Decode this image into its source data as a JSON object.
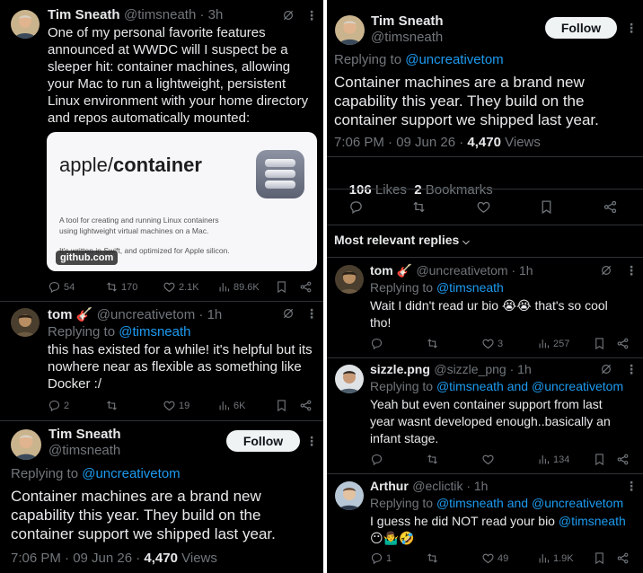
{
  "left": {
    "tweet1": {
      "name": "Tim Sneath",
      "handle_time": "@timsneath · 3h",
      "lines": [
        "One of my personal favorite features",
        "announced at WWDC will I suspect be a",
        "sleeper hit: container machines, allowing",
        "your Mac to run a lightweight, persistent",
        "Linux environment with your home directory",
        "and repos automatically mounted:"
      ],
      "card": {
        "title_prefix": "apple/",
        "title_bold": "container",
        "desc_line1": "A tool for creating and running Linux containers",
        "desc_line2": "using lightweight virtual machines on a Mac.",
        "foot": "It's written in Swift, and optimized for Apple silicon.",
        "domain": "github.com"
      },
      "replies": "54",
      "reposts": "170",
      "likes": "2.1K",
      "views": "89.6K"
    },
    "tweet2": {
      "name": "tom 🎸",
      "handle_time": "@uncreativetom · 1h",
      "replying_prefix": "Replying to",
      "replying_to": "@timsneath",
      "lines": [
        "this has existed for a while! it's helpful but its",
        "nowhere near as flexible as something like",
        "Docker :/"
      ],
      "replies": "2",
      "reposts": "",
      "likes": "19",
      "views": "6K"
    },
    "tweet3": {
      "name": "Tim Sneath",
      "handle": "@timsneath",
      "follow_label": "Follow",
      "replying_prefix": "Replying to",
      "replying_to": "@uncreativetom",
      "lines": [
        "Container machines are a brand new",
        "capability this year. They build on the",
        "container support we shipped last year."
      ],
      "meta_time": "7:06 PM · 09 Jun 26 · ",
      "meta_views": "4,470",
      "meta_views_label": " Views"
    }
  },
  "right": {
    "main": {
      "name": "Tim Sneath",
      "handle": "@timsneath",
      "follow_label": "Follow",
      "replying_prefix": "Replying to",
      "replying_to": "@uncreativetom",
      "lines": [
        "Container machines are a brand new",
        "capability this year. They build on the",
        "container support we shipped last year."
      ],
      "meta_time": "7:06 PM · 09 Jun 26 · ",
      "meta_views": "4,470",
      "meta_views_label": " Views",
      "likes_count": "106",
      "likes_label": " Likes  ",
      "bookmarks_count": "2",
      "bookmarks_label": " Bookmarks"
    },
    "sort_label": "Most relevant replies",
    "reply1": {
      "name": "tom 🎸",
      "handle_time": "@uncreativetom · 1h",
      "replying_prefix": "Replying to",
      "replying_to": "@timsneath",
      "lines": [
        "Wait I didn't read ur bio 😭😭 that's so cool",
        "tho!"
      ],
      "likes": "3",
      "views": "257"
    },
    "reply2": {
      "name": "sizzle.png",
      "handle_time": "@sizzle_png · 1h",
      "replying_prefix": "Replying to",
      "replying_to": "@timsneath and @uncreativetom",
      "lines": [
        "Yeah but even container support from last",
        "year wasnt developed enough..basically an",
        "infant stage."
      ],
      "views": "134"
    },
    "reply3": {
      "name": "Arthur",
      "handle_time": "@eclictik · 1h",
      "replying_prefix": "Replying to",
      "replying_to": "@timsneath and @uncreativetom",
      "line1_text": "I guess he did NOT read your bio ",
      "line1_link": "@timsneath",
      "line2": "😶🤷‍♂️🤣",
      "replies": "1",
      "likes": "49",
      "views": "1.9K"
    }
  },
  "colors": {
    "background": "#000000",
    "text": "#e7e9ea",
    "muted": "#71767b",
    "link": "#1d9bf0",
    "divider": "#2f3336",
    "follow_bg": "#eff3f4"
  },
  "icons": [
    "reply-icon",
    "repost-icon",
    "like-icon",
    "views-icon",
    "bookmark-icon",
    "share-icon",
    "grok-icon",
    "more-icon",
    "chevron-down-icon"
  ]
}
